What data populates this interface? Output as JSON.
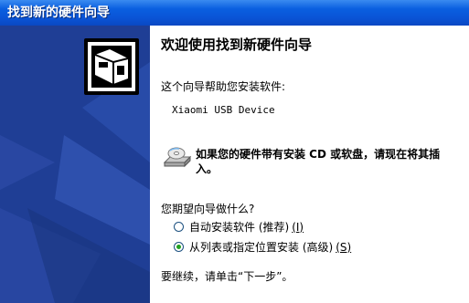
{
  "window": {
    "title": "找到新的硬件向导"
  },
  "main": {
    "heading": "欢迎使用找到新硬件向导",
    "intro": "这个向导帮助您安装软件:",
    "device_name": "Xiaomi USB Device",
    "cd_message": "如果您的硬件带有安装 CD 或软盘，请现在将其插入。",
    "question": "您期望向导做什么?",
    "options": [
      {
        "label": "自动安装软件 (推荐)",
        "hotkey": "(I)",
        "selected": false
      },
      {
        "label": "从列表或指定位置安装 (高级)",
        "hotkey": "(S)",
        "selected": true
      }
    ],
    "continue_text": "要继续，请单击“下一步”。"
  },
  "icons": {
    "wizard_logo": "hardware-wizard-icon",
    "cd": "cd-drive-icon"
  },
  "colors": {
    "sidebar": "#1f3e95",
    "titlebar": "#0a54d6",
    "radio_selected": "#21a121"
  }
}
